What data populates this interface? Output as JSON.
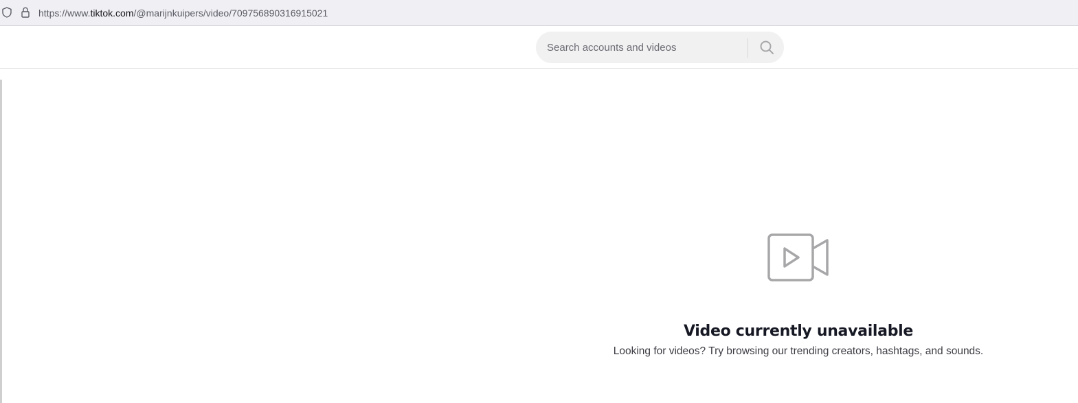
{
  "browser": {
    "url_prefix": "https://www.",
    "url_host": "tiktok.com",
    "url_path": "/@marijnkuipers/video/7097568903169150­21"
  },
  "search": {
    "placeholder": "Search accounts and videos"
  },
  "empty_state": {
    "title": "Video currently unavailable",
    "subtitle": "Looking for videos? Try browsing our trending creators, hashtags, and sounds."
  },
  "icons": {
    "shield": "shield-icon",
    "lock": "lock-icon",
    "search": "search-icon",
    "video": "video-camera-icon"
  },
  "colors": {
    "text_primary": "#161823",
    "search_bg": "#f1f1f2",
    "icon_gray": "#a7a7a9"
  }
}
